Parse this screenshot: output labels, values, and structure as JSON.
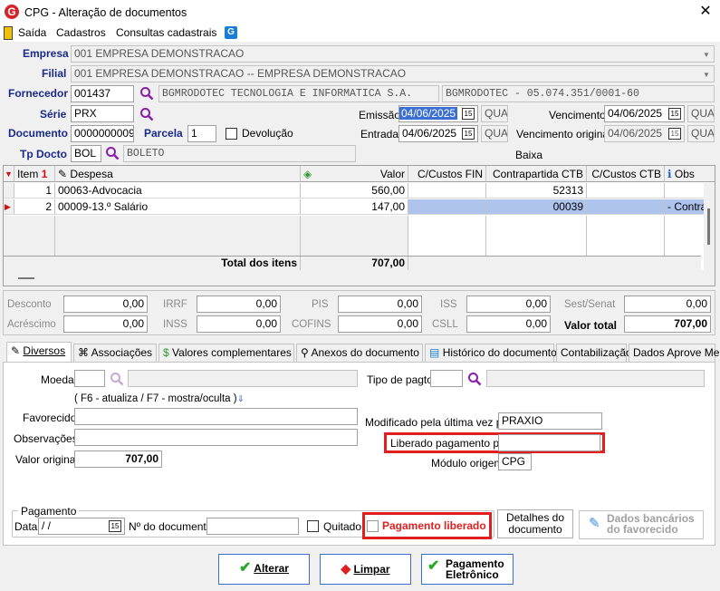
{
  "window": {
    "title": "CPG - Alteração de documentos",
    "close": "✕"
  },
  "menu": {
    "sair": "Saída",
    "cadastros": "Cadastros",
    "consultas": "Consultas cadastrais"
  },
  "header": {
    "empresa_label": "Empresa",
    "empresa_value": "001 EMPRESA DEMONSTRACAO",
    "filial_label": "Filial",
    "filial_value": "001 EMPRESA DEMONSTRACAO -- EMPRESA DEMONSTRACAO",
    "fornecedor_label": "Fornecedor",
    "fornecedor_code": "001437",
    "fornecedor_name": "BGMRODOTEC TECNOLOGIA E INFORMATICA S.A.",
    "fornecedor_doc": "BGMRODOTEC - 05.074.351/0001-60",
    "serie_label": "Série",
    "serie_value": "PRX",
    "documento_label": "Documento",
    "documento_value": "0000000009",
    "parcela_label": "Parcela",
    "parcela_value": "1",
    "devolucao_label": "Devolução",
    "tpdocto_label": "Tp Docto",
    "tpdocto_code": "BOL",
    "tpdocto_name": "BOLETO",
    "emissao_label": "Emissão",
    "emissao_value": "04/06/2025",
    "emissao_dow": "QUA",
    "entrada_label": "Entrada",
    "entrada_value": "04/06/2025",
    "entrada_dow": "QUA",
    "vencimento_label": "Vencimento",
    "vencimento_value": "04/06/2025",
    "vencimento_dow": "QUA",
    "vencorig_label": "Vencimento original",
    "vencorig_value": "04/06/2025",
    "vencorig_dow": "QUA",
    "baixa_label": "Baixa",
    "cal_icon": "15"
  },
  "grid": {
    "headers": {
      "item": "Item",
      "despesa": "Despesa",
      "valor": "Valor",
      "ccfin": "C/Custos FIN",
      "contrapartida": "Contrapartida CTB",
      "ccctb": "C/Custos CTB",
      "obs": "Obs"
    },
    "rows": [
      {
        "item": "1",
        "despesa": "00063-Advocacia",
        "valor": "560,00",
        "ccfin": "",
        "contrapartida": "52313",
        "ccctb": "",
        "obs": ""
      },
      {
        "item": "2",
        "despesa": "00009-13.º Salário",
        "valor": "147,00",
        "ccfin": "",
        "contrapartida": "00039",
        "ccctb": "",
        "obs": "- Contra"
      }
    ],
    "total_label": "Total dos itens",
    "total_value": "707,00",
    "sort_indicator": "1"
  },
  "totals": {
    "desconto_label": "Desconto",
    "desconto": "0,00",
    "irrf_label": "IRRF",
    "irrf": "0,00",
    "pis_label": "PIS",
    "pis": "0,00",
    "iss_label": "ISS",
    "iss": "0,00",
    "sest_label": "Sest/Senat",
    "sest": "0,00",
    "acrescimo_label": "Acréscimo",
    "acrescimo": "0,00",
    "inss_label": "INSS",
    "inss": "0,00",
    "cofins_label": "COFINS",
    "cofins": "0,00",
    "csll_label": "CSLL",
    "csll": "0,00",
    "valortotal_label": "Valor total",
    "valortotal": "707,00"
  },
  "tabs": [
    "Diversos",
    "Associações",
    "Valores complementares",
    "Anexos do documento",
    "Histórico do documento",
    "Contabilização",
    "Dados Aprove Me"
  ],
  "diversos": {
    "moeda_label": "Moeda",
    "tipopagto_label": "Tipo de pagto",
    "hint": "( F6 - atualiza / F7 - mostra/oculta )",
    "favorecido_label": "Favorecido",
    "observacoes_label": "Observações",
    "valororiginal_label": "Valor original",
    "valororiginal": "707,00",
    "modificado_label": "Modificado pela última vez por",
    "modificado_value": "PRAXIO",
    "liberado_label": "Liberado pagamento por",
    "liberado_value": "",
    "modulo_label": "Módulo origem",
    "modulo_value": "CPG",
    "pagamento_group": "Pagamento",
    "data_label": "Data",
    "data_value": " /  /",
    "ndoc_label": "Nº do documento",
    "quitado_label": "Quitado",
    "pagliberado_label": "Pagamento liberado",
    "detalhes_label": "Detalhes do documento",
    "dadosbancarios_label": "Dados bancários do favorecido"
  },
  "buttons": {
    "alterar": "Alterar",
    "limpar": "Limpar",
    "pagamento": "Pagamento Eletrônico"
  },
  "colors": {
    "accent": "#1a2a8a",
    "highlight": "#e02020",
    "selected_row": "#aec4ec",
    "date_sel": "#3b6fd4"
  }
}
